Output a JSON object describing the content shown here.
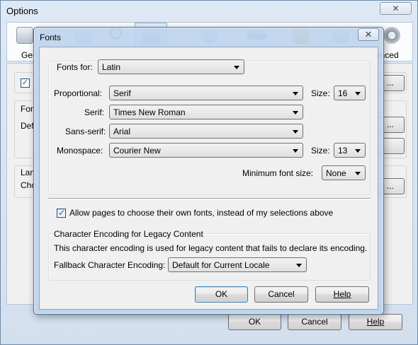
{
  "options_window": {
    "title": "Options",
    "close_label": "✕",
    "tabs": [
      {
        "label": "Gen",
        "icon": "general-icon"
      },
      {
        "label": "",
        "icon": "tabs-icon"
      },
      {
        "label": "",
        "icon": "search-icon"
      },
      {
        "label": "",
        "icon": "content-icon"
      },
      {
        "label": "",
        "icon": "applications-icon"
      },
      {
        "label": "",
        "icon": "privacy-icon"
      },
      {
        "label": "",
        "icon": "security-icon"
      },
      {
        "label": "",
        "icon": "sync-icon"
      },
      {
        "label": "anced",
        "icon": "advanced-icon"
      }
    ],
    "fragments": {
      "fon": "Fon",
      "def": "Def",
      "lan": "Lan",
      "cho": "Cho",
      "check_mark": "✓",
      "ellipsis1": "...",
      "ellipsis2": "...",
      "ellipsis3": "..."
    },
    "buttons": {
      "ok": "OK",
      "cancel": "Cancel",
      "help": "Help"
    }
  },
  "fonts_dialog": {
    "title": "Fonts",
    "close_label": "✕",
    "fonts_for": {
      "label": "Fonts for:",
      "value": "Latin"
    },
    "proportional": {
      "label": "Proportional:",
      "value": "Serif",
      "size_label": "Size:",
      "size": "16"
    },
    "serif": {
      "label": "Serif:",
      "value": "Times New Roman"
    },
    "sans_serif": {
      "label": "Sans-serif:",
      "value": "Arial"
    },
    "monospace": {
      "label": "Monospace:",
      "value": "Courier New",
      "size_label": "Size:",
      "size": "13"
    },
    "min_font": {
      "label": "Minimum font size:",
      "value": "None"
    },
    "allow_pages": {
      "checked": true,
      "label": "Allow pages to choose their own fonts, instead of my selections above"
    },
    "encoding": {
      "heading": "Character Encoding for Legacy Content",
      "description": "This character encoding is used for legacy content that fails to declare its encoding.",
      "fallback_label": "Fallback Character Encoding:",
      "fallback_value": "Default for Current Locale"
    },
    "buttons": {
      "ok": "OK",
      "cancel": "Cancel",
      "help": "Help"
    }
  },
  "colors": {
    "title_bar": "#bed4ee",
    "dialog_bg": "#f0f0f0",
    "default_button_border": "#3c7fb1"
  }
}
